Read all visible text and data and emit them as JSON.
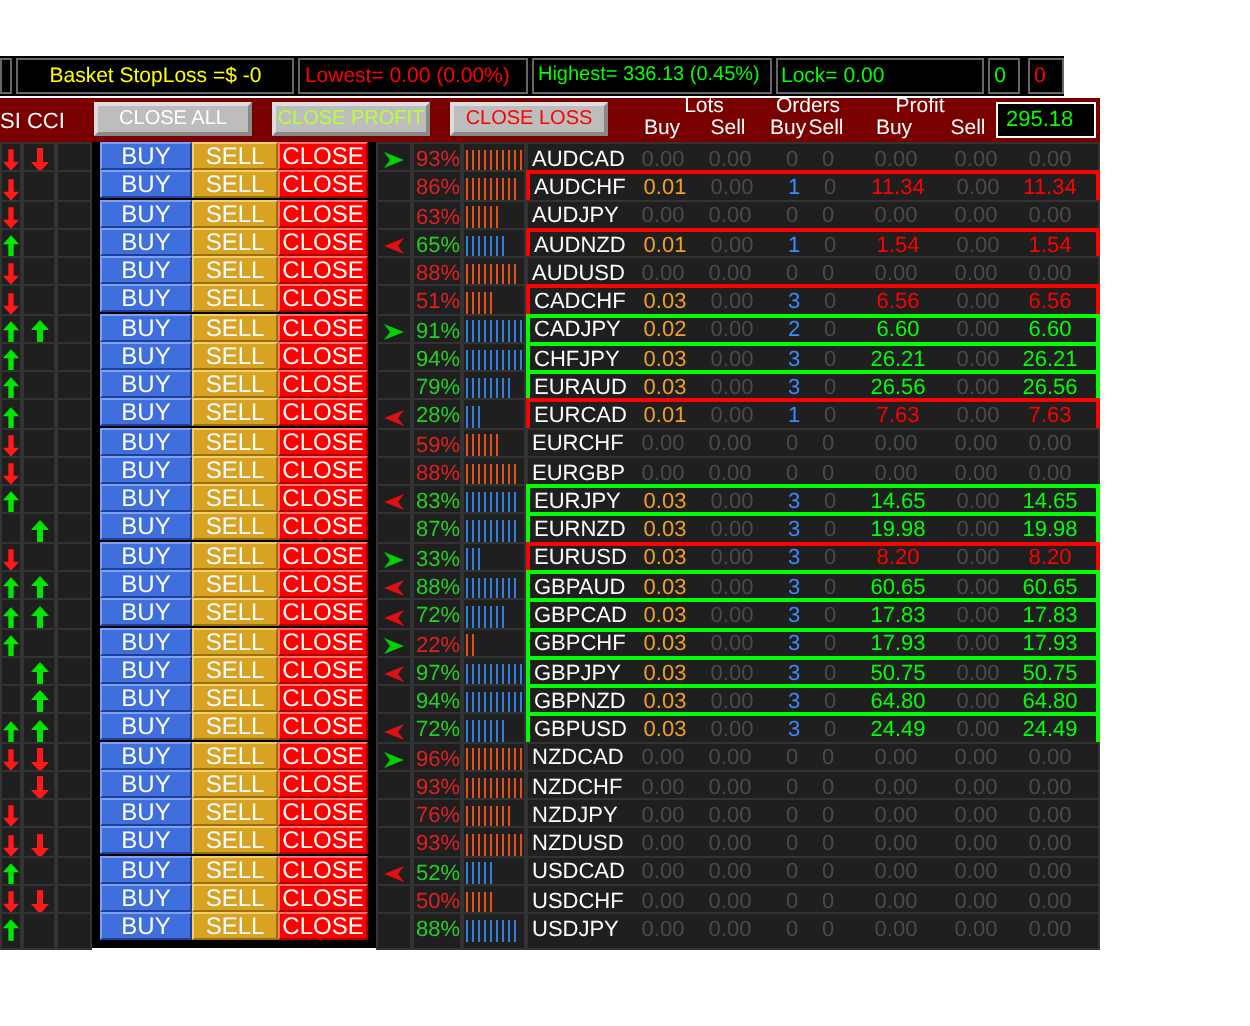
{
  "status_bar": {
    "stoploss": "Basket StopLoss =$ -0",
    "lowest": "Lowest= 0.00 (0.00%)",
    "highest": "Highest= 336.13 (0.45%)",
    "lock": "Lock= 0.00",
    "count_green": "0",
    "count_red": "0"
  },
  "header": {
    "indicator_label": "SI CCI",
    "buttons": [
      {
        "label": "CLOSE ALL",
        "kind": "all"
      },
      {
        "label": "CLOSE PROFIT",
        "kind": "profit"
      },
      {
        "label": "CLOSE LOSS",
        "kind": "loss"
      }
    ],
    "groups": [
      {
        "title": "Lots",
        "sub": [
          "Buy",
          "Sell"
        ]
      },
      {
        "title": "Orders",
        "sub": [
          "Buy",
          "Sell"
        ]
      },
      {
        "title": "Profit",
        "sub": [
          "Buy",
          "Sell"
        ]
      }
    ],
    "total": "295.18"
  },
  "rows": [
    {
      "pair": "AUDCAD",
      "rsi_up": false,
      "rsi_down": true,
      "cci_up": false,
      "cci_down": true,
      "signal_right": true,
      "signal_left": false,
      "strength": "93%",
      "bullish": false,
      "buy": "BUY",
      "sell": "SELL",
      "close": "CLOSE",
      "lots_buy": "0.00",
      "lots_sell": "0.00",
      "orders_buy": "0",
      "orders_sell": "0",
      "profit_buy": "0.00",
      "profit_sell": "0.00",
      "profit_total": "0.00"
    },
    {
      "pair": "AUDCHF",
      "rsi_up": false,
      "rsi_down": true,
      "cci_up": false,
      "cci_down": false,
      "signal_right": false,
      "signal_left": false,
      "strength": "86%",
      "bullish": false,
      "buy": "BUY",
      "sell": "SELL",
      "close": "CLOSE",
      "lots_buy": "0.01",
      "lots_sell": "0.00",
      "orders_buy": "1",
      "orders_sell": "0",
      "profit_buy": "11.34",
      "profit_sell": "0.00",
      "profit_total": "11.34",
      "color": "#ff0000"
    },
    {
      "pair": "AUDJPY",
      "rsi_up": false,
      "rsi_down": true,
      "cci_up": false,
      "cci_down": false,
      "signal_right": false,
      "signal_left": false,
      "strength": "63%",
      "bullish": false,
      "buy": "BUY",
      "sell": "SELL",
      "close": "CLOSE",
      "lots_buy": "0.00",
      "lots_sell": "0.00",
      "orders_buy": "0",
      "orders_sell": "0",
      "profit_buy": "0.00",
      "profit_sell": "0.00",
      "profit_total": "0.00"
    },
    {
      "pair": "AUDNZD",
      "rsi_up": true,
      "rsi_down": false,
      "cci_up": false,
      "cci_down": false,
      "signal_right": false,
      "signal_left": true,
      "strength": "65%",
      "bullish": true,
      "buy": "BUY",
      "sell": "SELL",
      "close": "CLOSE",
      "lots_buy": "0.01",
      "lots_sell": "0.00",
      "orders_buy": "1",
      "orders_sell": "0",
      "profit_buy": "1.54",
      "profit_sell": "0.00",
      "profit_total": "1.54",
      "color": "#ff0000"
    },
    {
      "pair": "AUDUSD",
      "rsi_up": false,
      "rsi_down": true,
      "cci_up": false,
      "cci_down": false,
      "signal_right": false,
      "signal_left": false,
      "strength": "88%",
      "bullish": false,
      "buy": "BUY",
      "sell": "SELL",
      "close": "CLOSE",
      "lots_buy": "0.00",
      "lots_sell": "0.00",
      "orders_buy": "0",
      "orders_sell": "0",
      "profit_buy": "0.00",
      "profit_sell": "0.00",
      "profit_total": "0.00"
    },
    {
      "pair": "CADCHF",
      "rsi_up": false,
      "rsi_down": true,
      "cci_up": false,
      "cci_down": false,
      "signal_right": false,
      "signal_left": false,
      "strength": "51%",
      "bullish": false,
      "buy": "BUY",
      "sell": "SELL",
      "close": "CLOSE",
      "lots_buy": "0.03",
      "lots_sell": "0.00",
      "orders_buy": "3",
      "orders_sell": "0",
      "profit_buy": "6.56",
      "profit_sell": "0.00",
      "profit_total": "6.56",
      "color": "#ff0000"
    },
    {
      "pair": "CADJPY",
      "rsi_up": true,
      "rsi_down": false,
      "cci_up": true,
      "cci_down": false,
      "signal_right": true,
      "signal_left": false,
      "strength": "91%",
      "bullish": true,
      "buy": "BUY",
      "sell": "SELL",
      "close": "CLOSE",
      "lots_buy": "0.02",
      "lots_sell": "0.00",
      "orders_buy": "2",
      "orders_sell": "0",
      "profit_buy": "6.60",
      "profit_sell": "0.00",
      "profit_total": "6.60",
      "color": "#00ff00"
    },
    {
      "pair": "CHFJPY",
      "rsi_up": true,
      "rsi_down": false,
      "cci_up": false,
      "cci_down": false,
      "signal_right": false,
      "signal_left": false,
      "strength": "94%",
      "bullish": true,
      "buy": "BUY",
      "sell": "SELL",
      "close": "CLOSE",
      "lots_buy": "0.03",
      "lots_sell": "0.00",
      "orders_buy": "3",
      "orders_sell": "0",
      "profit_buy": "26.21",
      "profit_sell": "0.00",
      "profit_total": "26.21",
      "color": "#00ff00"
    },
    {
      "pair": "EURAUD",
      "rsi_up": true,
      "rsi_down": false,
      "cci_up": false,
      "cci_down": false,
      "signal_right": false,
      "signal_left": false,
      "strength": "79%",
      "bullish": true,
      "buy": "BUY",
      "sell": "SELL",
      "close": "CLOSE",
      "lots_buy": "0.03",
      "lots_sell": "0.00",
      "orders_buy": "3",
      "orders_sell": "0",
      "profit_buy": "26.56",
      "profit_sell": "0.00",
      "profit_total": "26.56",
      "color": "#00ff00"
    },
    {
      "pair": "EURCAD",
      "rsi_up": true,
      "rsi_down": false,
      "cci_up": false,
      "cci_down": false,
      "signal_right": false,
      "signal_left": true,
      "strength": "28%",
      "bullish": true,
      "buy": "BUY",
      "sell": "SELL",
      "close": "CLOSE",
      "lots_buy": "0.01",
      "lots_sell": "0.00",
      "orders_buy": "1",
      "orders_sell": "0",
      "profit_buy": "7.63",
      "profit_sell": "0.00",
      "profit_total": "7.63",
      "color": "#ff0000"
    },
    {
      "pair": "EURCHF",
      "rsi_up": false,
      "rsi_down": true,
      "cci_up": false,
      "cci_down": false,
      "signal_right": false,
      "signal_left": false,
      "strength": "59%",
      "bullish": false,
      "buy": "BUY",
      "sell": "SELL",
      "close": "CLOSE",
      "lots_buy": "0.00",
      "lots_sell": "0.00",
      "orders_buy": "0",
      "orders_sell": "0",
      "profit_buy": "0.00",
      "profit_sell": "0.00",
      "profit_total": "0.00"
    },
    {
      "pair": "EURGBP",
      "rsi_up": false,
      "rsi_down": true,
      "cci_up": false,
      "cci_down": false,
      "signal_right": false,
      "signal_left": false,
      "strength": "88%",
      "bullish": false,
      "buy": "BUY",
      "sell": "SELL",
      "close": "CLOSE",
      "lots_buy": "0.00",
      "lots_sell": "0.00",
      "orders_buy": "0",
      "orders_sell": "0",
      "profit_buy": "0.00",
      "profit_sell": "0.00",
      "profit_total": "0.00"
    },
    {
      "pair": "EURJPY",
      "rsi_up": true,
      "rsi_down": false,
      "cci_up": false,
      "cci_down": false,
      "signal_right": false,
      "signal_left": true,
      "strength": "83%",
      "bullish": true,
      "buy": "BUY",
      "sell": "SELL",
      "close": "CLOSE",
      "lots_buy": "0.03",
      "lots_sell": "0.00",
      "orders_buy": "3",
      "orders_sell": "0",
      "profit_buy": "14.65",
      "profit_sell": "0.00",
      "profit_total": "14.65",
      "color": "#00ff00"
    },
    {
      "pair": "EURNZD",
      "rsi_up": false,
      "rsi_down": false,
      "cci_up": true,
      "cci_down": false,
      "signal_right": false,
      "signal_left": false,
      "strength": "87%",
      "bullish": true,
      "buy": "BUY",
      "sell": "SELL",
      "close": "CLOSE",
      "lots_buy": "0.03",
      "lots_sell": "0.00",
      "orders_buy": "3",
      "orders_sell": "0",
      "profit_buy": "19.98",
      "profit_sell": "0.00",
      "profit_total": "19.98",
      "color": "#00ff00"
    },
    {
      "pair": "EURUSD",
      "rsi_up": false,
      "rsi_down": true,
      "cci_up": false,
      "cci_down": false,
      "signal_right": true,
      "signal_left": false,
      "strength": "33%",
      "bullish": true,
      "buy": "BUY",
      "sell": "SELL",
      "close": "CLOSE",
      "lots_buy": "0.03",
      "lots_sell": "0.00",
      "orders_buy": "3",
      "orders_sell": "0",
      "profit_buy": "8.20",
      "profit_sell": "0.00",
      "profit_total": "8.20",
      "color": "#ff0000"
    },
    {
      "pair": "GBPAUD",
      "rsi_up": true,
      "rsi_down": false,
      "cci_up": true,
      "cci_down": false,
      "signal_right": false,
      "signal_left": true,
      "strength": "88%",
      "bullish": true,
      "buy": "BUY",
      "sell": "SELL",
      "close": "CLOSE",
      "lots_buy": "0.03",
      "lots_sell": "0.00",
      "orders_buy": "3",
      "orders_sell": "0",
      "profit_buy": "60.65",
      "profit_sell": "0.00",
      "profit_total": "60.65",
      "color": "#00ff00"
    },
    {
      "pair": "GBPCAD",
      "rsi_up": true,
      "rsi_down": false,
      "cci_up": true,
      "cci_down": false,
      "signal_right": false,
      "signal_left": true,
      "strength": "72%",
      "bullish": true,
      "buy": "BUY",
      "sell": "SELL",
      "close": "CLOSE",
      "lots_buy": "0.03",
      "lots_sell": "0.00",
      "orders_buy": "3",
      "orders_sell": "0",
      "profit_buy": "17.83",
      "profit_sell": "0.00",
      "profit_total": "17.83",
      "color": "#00ff00"
    },
    {
      "pair": "GBPCHF",
      "rsi_up": true,
      "rsi_down": false,
      "cci_up": false,
      "cci_down": false,
      "signal_right": true,
      "signal_left": false,
      "strength": "22%",
      "bullish": false,
      "buy": "BUY",
      "sell": "SELL",
      "close": "CLOSE",
      "lots_buy": "0.03",
      "lots_sell": "0.00",
      "orders_buy": "3",
      "orders_sell": "0",
      "profit_buy": "17.93",
      "profit_sell": "0.00",
      "profit_total": "17.93",
      "color": "#00ff00"
    },
    {
      "pair": "GBPJPY",
      "rsi_up": false,
      "rsi_down": false,
      "cci_up": true,
      "cci_down": false,
      "signal_right": false,
      "signal_left": true,
      "strength": "97%",
      "bullish": true,
      "buy": "BUY",
      "sell": "SELL",
      "close": "CLOSE",
      "lots_buy": "0.03",
      "lots_sell": "0.00",
      "orders_buy": "3",
      "orders_sell": "0",
      "profit_buy": "50.75",
      "profit_sell": "0.00",
      "profit_total": "50.75",
      "color": "#00ff00"
    },
    {
      "pair": "GBPNZD",
      "rsi_up": false,
      "rsi_down": false,
      "cci_up": true,
      "cci_down": false,
      "signal_right": false,
      "signal_left": false,
      "strength": "94%",
      "bullish": true,
      "buy": "BUY",
      "sell": "SELL",
      "close": "CLOSE",
      "lots_buy": "0.03",
      "lots_sell": "0.00",
      "orders_buy": "3",
      "orders_sell": "0",
      "profit_buy": "64.80",
      "profit_sell": "0.00",
      "profit_total": "64.80",
      "color": "#00ff00"
    },
    {
      "pair": "GBPUSD",
      "rsi_up": true,
      "rsi_down": false,
      "cci_up": true,
      "cci_down": false,
      "signal_right": false,
      "signal_left": true,
      "strength": "72%",
      "bullish": true,
      "buy": "BUY",
      "sell": "SELL",
      "close": "CLOSE",
      "lots_buy": "0.03",
      "lots_sell": "0.00",
      "orders_buy": "3",
      "orders_sell": "0",
      "profit_buy": "24.49",
      "profit_sell": "0.00",
      "profit_total": "24.49",
      "color": "#00ff00"
    },
    {
      "pair": "NZDCAD",
      "rsi_up": false,
      "rsi_down": true,
      "cci_up": false,
      "cci_down": true,
      "signal_right": true,
      "signal_left": false,
      "strength": "96%",
      "bullish": false,
      "buy": "BUY",
      "sell": "SELL",
      "close": "CLOSE",
      "lots_buy": "0.00",
      "lots_sell": "0.00",
      "orders_buy": "0",
      "orders_sell": "0",
      "profit_buy": "0.00",
      "profit_sell": "0.00",
      "profit_total": "0.00"
    },
    {
      "pair": "NZDCHF",
      "rsi_up": false,
      "rsi_down": false,
      "cci_up": false,
      "cci_down": true,
      "signal_right": false,
      "signal_left": false,
      "strength": "93%",
      "bullish": false,
      "buy": "BUY",
      "sell": "SELL",
      "close": "CLOSE",
      "lots_buy": "0.00",
      "lots_sell": "0.00",
      "orders_buy": "0",
      "orders_sell": "0",
      "profit_buy": "0.00",
      "profit_sell": "0.00",
      "profit_total": "0.00"
    },
    {
      "pair": "NZDJPY",
      "rsi_up": false,
      "rsi_down": true,
      "cci_up": false,
      "cci_down": false,
      "signal_right": false,
      "signal_left": false,
      "strength": "76%",
      "bullish": false,
      "buy": "BUY",
      "sell": "SELL",
      "close": "CLOSE",
      "lots_buy": "0.00",
      "lots_sell": "0.00",
      "orders_buy": "0",
      "orders_sell": "0",
      "profit_buy": "0.00",
      "profit_sell": "0.00",
      "profit_total": "0.00"
    },
    {
      "pair": "NZDUSD",
      "rsi_up": false,
      "rsi_down": true,
      "cci_up": false,
      "cci_down": true,
      "signal_right": false,
      "signal_left": false,
      "strength": "93%",
      "bullish": false,
      "buy": "BUY",
      "sell": "SELL",
      "close": "CLOSE",
      "lots_buy": "0.00",
      "lots_sell": "0.00",
      "orders_buy": "0",
      "orders_sell": "0",
      "profit_buy": "0.00",
      "profit_sell": "0.00",
      "profit_total": "0.00"
    },
    {
      "pair": "USDCAD",
      "rsi_up": true,
      "rsi_down": false,
      "cci_up": false,
      "cci_down": false,
      "signal_right": false,
      "signal_left": true,
      "strength": "52%",
      "bullish": true,
      "buy": "BUY",
      "sell": "SELL",
      "close": "CLOSE",
      "lots_buy": "0.00",
      "lots_sell": "0.00",
      "orders_buy": "0",
      "orders_sell": "0",
      "profit_buy": "0.00",
      "profit_sell": "0.00",
      "profit_total": "0.00"
    },
    {
      "pair": "USDCHF",
      "rsi_up": false,
      "rsi_down": true,
      "cci_up": false,
      "cci_down": true,
      "signal_right": false,
      "signal_left": false,
      "strength": "50%",
      "bullish": false,
      "buy": "BUY",
      "sell": "SELL",
      "close": "CLOSE",
      "lots_buy": "0.00",
      "lots_sell": "0.00",
      "orders_buy": "0",
      "orders_sell": "0",
      "profit_buy": "0.00",
      "profit_sell": "0.00",
      "profit_total": "0.00"
    },
    {
      "pair": "USDJPY",
      "rsi_up": true,
      "rsi_down": false,
      "cci_up": false,
      "cci_down": false,
      "signal_right": false,
      "signal_left": false,
      "strength": "88%",
      "bullish": true,
      "buy": "BUY",
      "sell": "SELL",
      "close": "CLOSE",
      "lots_buy": "0.00",
      "lots_sell": "0.00",
      "orders_buy": "0",
      "orders_sell": "0",
      "profit_buy": "0.00",
      "profit_sell": "0.00",
      "profit_total": "0.00"
    }
  ]
}
